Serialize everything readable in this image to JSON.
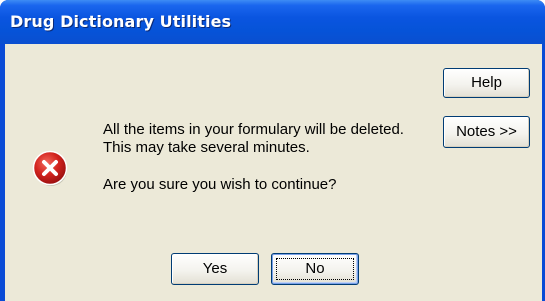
{
  "window": {
    "title": "Drug Dictionary Utilities"
  },
  "message": {
    "icon": "error-icon",
    "line1": "All the items in your formulary will be deleted.",
    "line2": "This may take several minutes.",
    "question": "Are you sure you wish to continue?"
  },
  "buttons": {
    "help": "Help",
    "notes": "Notes >>",
    "yes": "Yes",
    "no": "No"
  },
  "colors": {
    "titlebar": "#0a55e0",
    "client": "#ece9d8",
    "error_red": "#d2231e"
  }
}
